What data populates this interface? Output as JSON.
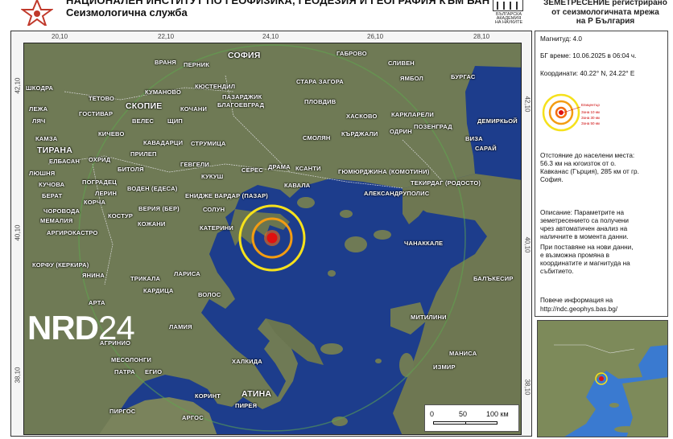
{
  "header": {
    "institute": "НАЦИОНАЛЕН ИНСТИТУТ ПО ГЕОФИЗИКА, ГЕОДЕЗИЯ И ГЕОГРАФИЯ КЪМ БАН",
    "service": "Сеизмологична служба",
    "bas_logo_line1": "БЪЛГАРСКА",
    "bas_logo_line2": "АКАДЕМИЯ",
    "bas_logo_line3": "НА НАУКИТЕ",
    "registration_note": [
      "ЗЕМЕТРЕСЕНИЕ регистрирано",
      "от сеизмологичната мрежа",
      "на Р България"
    ]
  },
  "map": {
    "top_labels": [
      "20,10",
      "22,10",
      "24,10",
      "26,10",
      "28,10"
    ],
    "left_labels": [
      "42,10",
      "40,10",
      "38,10"
    ],
    "right_labels": [
      "42,10",
      "40,10",
      "38,10"
    ],
    "places": [
      {
        "name": "ВРАНЯ"
      },
      {
        "name": "ПЕРНИК"
      },
      {
        "name": "СОФИЯ",
        "big": true
      },
      {
        "name": "ГАБРОВО"
      },
      {
        "name": "СЛИВЕН"
      },
      {
        "name": "ЯМБОЛ"
      },
      {
        "name": "БУРГАС"
      },
      {
        "name": "ШКОДРА"
      },
      {
        "name": "ТЕТОВО"
      },
      {
        "name": "КУМАНОВО"
      },
      {
        "name": "КЮСТЕНДИЛ"
      },
      {
        "name": "ПАЗАРДЖИК"
      },
      {
        "name": "СТАРА ЗАГОРА"
      },
      {
        "name": "ЛЕЖА"
      },
      {
        "name": "ГОСТИВАР"
      },
      {
        "name": "СКОПИЕ",
        "big": true
      },
      {
        "name": "КОЧАНИ"
      },
      {
        "name": "БЛАГОЕВГРАД"
      },
      {
        "name": "ПЛОВДИВ"
      },
      {
        "name": "ЛЯЧ"
      },
      {
        "name": "ВЕЛЕС"
      },
      {
        "name": "ЩИП"
      },
      {
        "name": "ХАСКОВО"
      },
      {
        "name": "КАРКЛАРЕЛИ"
      },
      {
        "name": "ДЕМИРКЬОЙ"
      },
      {
        "name": "КИЧЕВО"
      },
      {
        "name": "ОДРИН"
      },
      {
        "name": "ПОЗЕНГРАД"
      },
      {
        "name": "КАМЗА"
      },
      {
        "name": "КАВАДАРЦИ"
      },
      {
        "name": "СТРУМИЦА"
      },
      {
        "name": "СМОЛЯН"
      },
      {
        "name": "КЪРДЖАЛИ"
      },
      {
        "name": "ВИЗА"
      },
      {
        "name": "ТИРАНА",
        "big": true
      },
      {
        "name": "ОХРИД"
      },
      {
        "name": "ПРИЛЕП"
      },
      {
        "name": "САРАЙ"
      },
      {
        "name": "ЕЛБАСАН"
      },
      {
        "name": "ГЕВГЕЛИ"
      },
      {
        "name": "СЕРЕС"
      },
      {
        "name": "ДРАМА"
      },
      {
        "name": "КСАНТИ"
      },
      {
        "name": "ГЮМЮРДЖИНА (КОМОТИНИ)"
      },
      {
        "name": "ЛЮШНЯ"
      },
      {
        "name": "ПОГРАДЕЦ"
      },
      {
        "name": "БИТОЛЯ"
      },
      {
        "name": "КУКУШ"
      },
      {
        "name": "ТЕКИРДАГ (РОДОСТО)"
      },
      {
        "name": "КУЧОВА"
      },
      {
        "name": "ЛЕРИН"
      },
      {
        "name": "ВОДЕН (ЕДЕСА)"
      },
      {
        "name": "ЕНИДЖЕ ВАРДАР (ПАЗАР)"
      },
      {
        "name": "КАВАЛА"
      },
      {
        "name": "АЛЕКСАНДРУПОЛИС"
      },
      {
        "name": "БЕРАТ"
      },
      {
        "name": "КОРЧА"
      },
      {
        "name": "СОЛУН"
      },
      {
        "name": "ЧОРОВОДА"
      },
      {
        "name": "КОСТУР"
      },
      {
        "name": "ВЕРИЯ (БЕР)"
      },
      {
        "name": "МЕМАЛИЯ"
      },
      {
        "name": "КОЖАНИ"
      },
      {
        "name": "АРГИРОКАСТРО"
      },
      {
        "name": "КАТЕРИНИ"
      },
      {
        "name": "ЧАНАККАЛЕ"
      },
      {
        "name": "КОРФУ (КЕРКИРА)"
      },
      {
        "name": "ЯНИНА"
      },
      {
        "name": "ТРИКАЛА"
      },
      {
        "name": "ЛАРИСА"
      },
      {
        "name": "БАЛЪКЕСИР"
      },
      {
        "name": "КАРДИЦА"
      },
      {
        "name": "ВОЛОС"
      },
      {
        "name": "АРТА"
      },
      {
        "name": "МИТИЛИНИ"
      },
      {
        "name": "ЛАМИЯ"
      },
      {
        "name": "АГРИНИО"
      },
      {
        "name": "МЕСОЛОНГИ"
      },
      {
        "name": "ХАЛКИДА"
      },
      {
        "name": "МАНИСА"
      },
      {
        "name": "ПАТРА"
      },
      {
        "name": "ЕГИО"
      },
      {
        "name": "ИЗМИР"
      },
      {
        "name": "АТИНА",
        "big": true
      },
      {
        "name": "КОРИНТ"
      },
      {
        "name": "ПИРЕЯ"
      },
      {
        "name": "ПИРГОС"
      },
      {
        "name": "АРГОС"
      }
    ],
    "scale_labels": [
      "0",
      "50",
      "100 км"
    ]
  },
  "info": {
    "magnitude": "Магнитуд: 4.0",
    "time": "БГ време: 10.06.2025 в 06:04 ч.",
    "coordinates": "Координати: 40.22° N, 24.22° E",
    "legend": {
      "epicenter": "Епицентър",
      "zone1": "Зона 10 км",
      "zone2": "Зона 30 км",
      "zone3": "Зона 50 км"
    },
    "distance": [
      "Отстояние до населени места:",
      "56.3 км на югоизток от о.",
      "Кавканас (Гърция), 285 км от гр.",
      "София."
    ],
    "description": [
      "Описание: Параметрите на",
      "земетресението са получени",
      "чрез автоматичен анализ на",
      "наличните в момента данни.",
      "При поставяне на нови данни,",
      "е възможна промяна в",
      "координатите и магнитуда на",
      "събитието."
    ],
    "more_info": [
      "Повече информация на",
      "http://ndc.geophys.bas.bg/"
    ]
  },
  "watermark": {
    "bold": "NRD",
    "thin": "24"
  },
  "colors": {
    "sea": "#1d3d8c",
    "land": "#6f7a55",
    "epicenter": "#e01010",
    "ring_inner": "#f39c12",
    "ring_outer": "#f5e11c"
  }
}
